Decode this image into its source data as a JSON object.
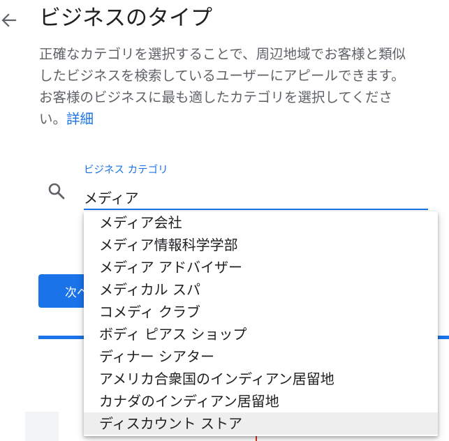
{
  "header": {
    "title": "ビジネスのタイプ"
  },
  "description": {
    "lines": [
      "正確なカテゴリを選択することで、周辺地域でお客様と類似",
      "したビジネスを検索しているユーザーにアピールできます。",
      "お客様のビジネスに最も適したカテゴリを選択してくださ"
    ],
    "last_prefix": "い。",
    "link_label": "詳細"
  },
  "search": {
    "label": "ビジネス カテゴリ",
    "value": "メディア"
  },
  "next_button": {
    "label": "次へ"
  },
  "dropdown": {
    "highlighted_index": 9,
    "options": [
      "メディア会社",
      "メディア情報科学学部",
      "メディア アドバイザー",
      "メディカル スパ",
      "コメディ クラブ",
      "ボディ ピアス ショップ",
      "ディナー シアター",
      "アメリカ合衆国のインディアン居留地",
      "カナダのインディアン居留地",
      "ディスカウント ストア"
    ]
  },
  "colors": {
    "accent": "#1a73e8",
    "text": "#202124",
    "secondary_text": "#5f6368"
  },
  "icons": {
    "back": "arrow-left-icon",
    "search": "search-icon"
  }
}
